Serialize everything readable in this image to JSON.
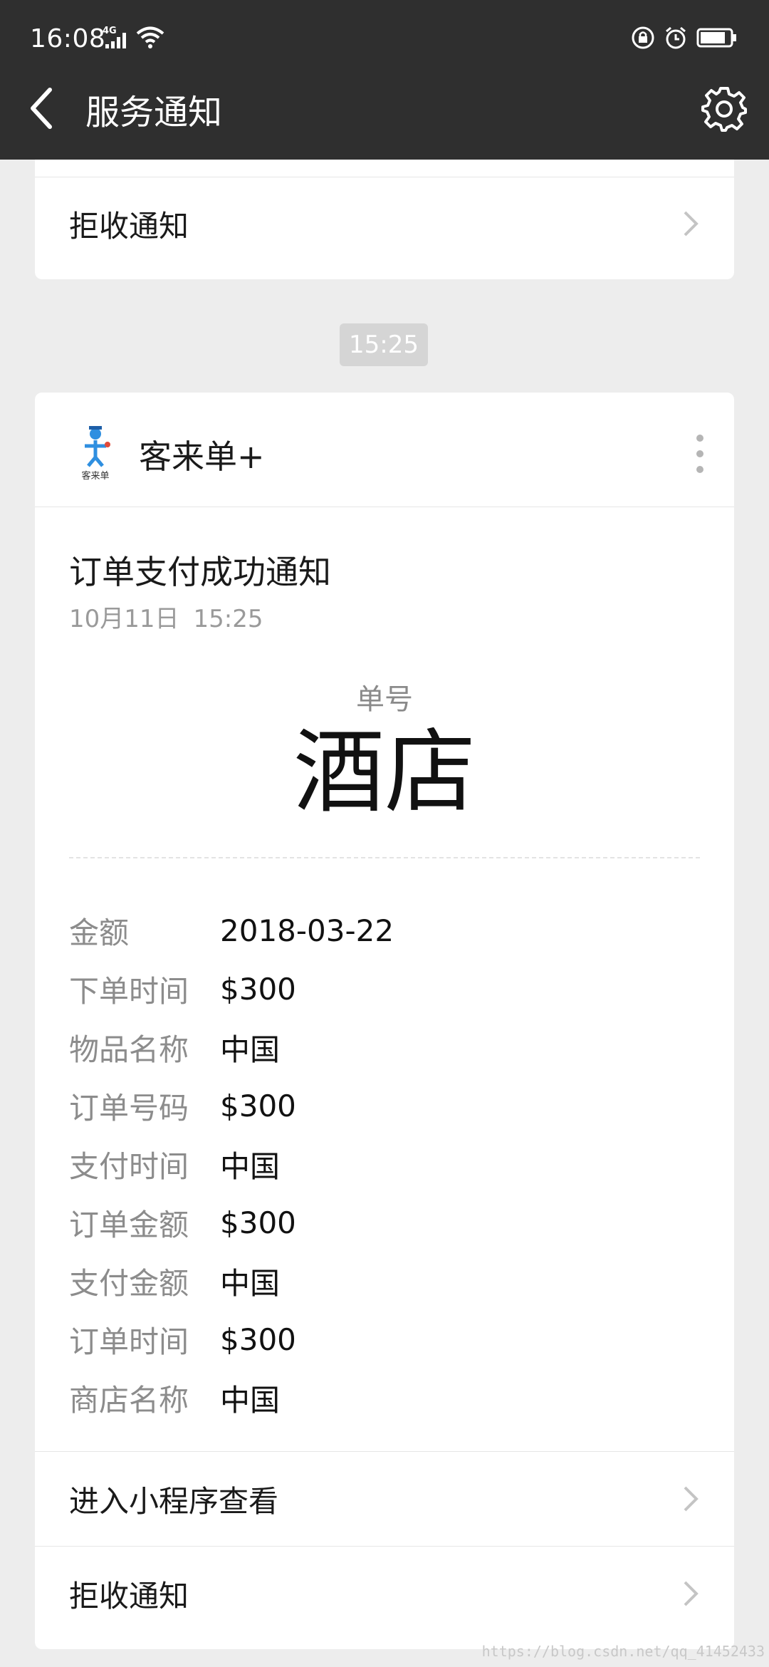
{
  "status_bar": {
    "time": "16:08",
    "network": "4G",
    "icons": [
      "signal-icon",
      "wifi-icon",
      "screen-lock-icon",
      "alarm-icon",
      "battery-icon"
    ]
  },
  "header": {
    "title": "服务通知",
    "back_icon": "back-arrow-icon",
    "settings_icon": "gear-icon",
    "background": "#2f2f2f"
  },
  "top_card": {
    "reject_label": "拒收通知"
  },
  "timestamp": "15:25",
  "message": {
    "app_name": "客来单+",
    "logo_caption": "客来单",
    "title": "订单支付成功通知",
    "date": "10月11日",
    "time": "15:25",
    "key_label": "单号",
    "key_value": "酒店",
    "fields": [
      {
        "label": "金额",
        "value": "2018-03-22"
      },
      {
        "label": "下单时间",
        "value": "$300"
      },
      {
        "label": "物品名称",
        "value": "中国"
      },
      {
        "label": "订单号码",
        "value": "$300"
      },
      {
        "label": "支付时间",
        "value": "中国"
      },
      {
        "label": "订单金额",
        "value": "$300"
      },
      {
        "label": "支付金额",
        "value": "中国"
      },
      {
        "label": "订单时间",
        "value": "$300"
      },
      {
        "label": "商店名称",
        "value": "中国"
      }
    ],
    "open_miniprogram_label": "进入小程序查看",
    "reject_label": "拒收通知"
  },
  "watermark": "https://blog.csdn.net/qq_41452433"
}
